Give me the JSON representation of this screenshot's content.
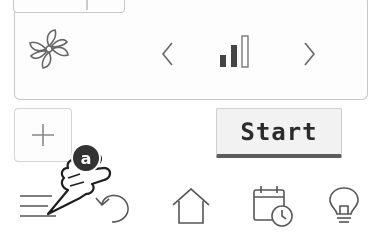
{
  "controls": {
    "start_label": "Start",
    "add_symbol": "+"
  },
  "overlay": {
    "badge_letter": "a"
  },
  "icons": {
    "fan": "fan-icon",
    "prev": "chevron-left-icon",
    "level": "fan-speed-level-icon",
    "next": "chevron-right-icon",
    "menu": "menu-icon",
    "undo": "undo-icon",
    "home": "home-icon",
    "timer": "timer-icon",
    "light": "lightbulb-icon",
    "hand": "pointing-hand-icon"
  },
  "fan_speed": {
    "level": 2,
    "max": 3
  }
}
